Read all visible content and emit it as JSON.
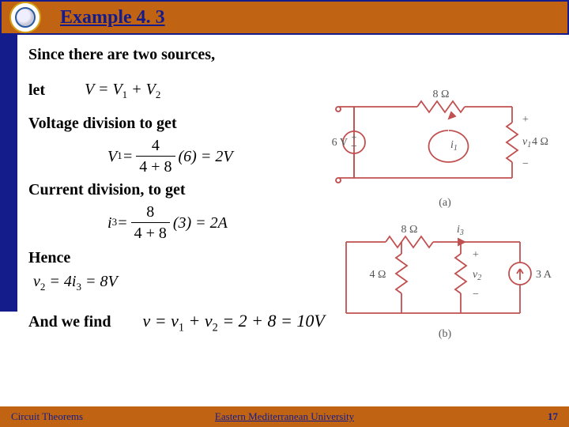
{
  "header": {
    "title": "Example 4. 3"
  },
  "body": {
    "line1": "Since  there are two sources,",
    "let": "let",
    "eq_let": {
      "lhs": "V",
      "rhs": "V₁ + V₂",
      "raw": "V = V1 + V2"
    },
    "line2": "Voltage division to get",
    "eq_v1": {
      "var": "V1",
      "num": "4",
      "den": "4 + 8",
      "mult": "(6)",
      "result": "2V",
      "raw": "V1 = 4/(4+8) (6) = 2V"
    },
    "line3": "Current division, to get",
    "eq_i3": {
      "var": "i3",
      "num": "8",
      "den": "4 + 8",
      "mult": "(3)",
      "result": "2A",
      "raw": "i3 = 8/(4+8) (3) = 2A"
    },
    "line4": "Hence",
    "eq_v2": {
      "raw": "v2 = 4 i3 = 8V",
      "text": "v₂ = 4i₃ = 8V"
    },
    "line5": "And we find",
    "eq_final": {
      "raw": "v = v1 + v2 = 2 + 8 = 10V",
      "text": "v = v₁ + v₂ = 2 + 8 = 10V"
    }
  },
  "circuit_a": {
    "label": "(a)",
    "voltage_source": "6 V",
    "r_top": "8 Ω",
    "r_right": "4 Ω",
    "current": "i₁",
    "v_out": "v₁"
  },
  "circuit_b": {
    "label": "(b)",
    "r_top": "8 Ω",
    "r_left": "4 Ω",
    "current_top": "i₃",
    "current_source": "3 A",
    "v_out": "v₂"
  },
  "footer": {
    "left": "Circuit Theorems",
    "center": "Eastern Mediterranean University",
    "page": "17"
  }
}
